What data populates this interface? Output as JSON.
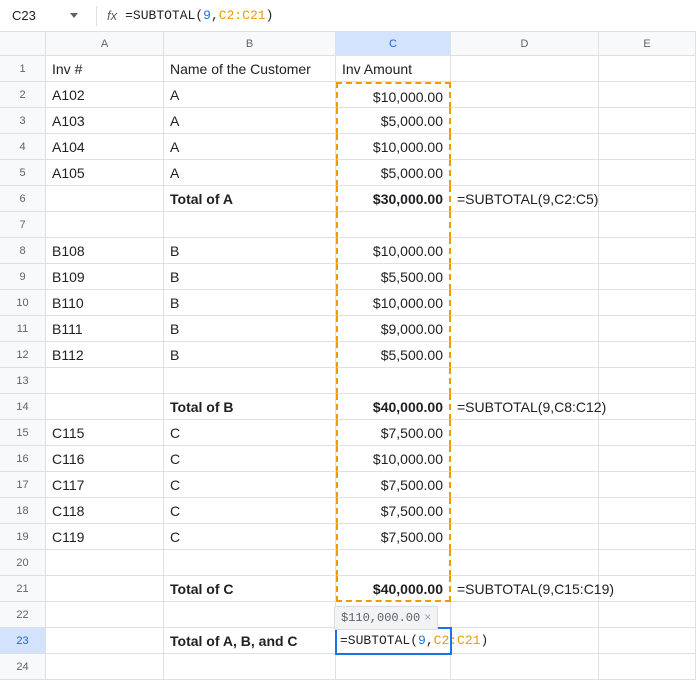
{
  "nameBox": "C23",
  "formulaBar": {
    "prefix": "=SUBTOTAL",
    "open": "(",
    "arg1": "9",
    "sep": ",",
    "arg2": "C2:C21",
    "close": ")"
  },
  "columns": [
    "A",
    "B",
    "C",
    "D",
    "E"
  ],
  "tooltip": {
    "value": "$110,000.00",
    "close": "×"
  },
  "activeFormula": {
    "prefix": "=SUBTOTAL",
    "open": "(",
    "arg1": "9",
    "sep": ",",
    "arg2": "C2:C21",
    "close": ")"
  },
  "rows": [
    {
      "n": "1",
      "a": "Inv #",
      "b": "Name of the Customer",
      "c": "Inv Amount",
      "d": "",
      "cClass": ""
    },
    {
      "n": "2",
      "a": "A102",
      "b": "A",
      "c": "$10,000.00",
      "d": "",
      "cClass": "num"
    },
    {
      "n": "3",
      "a": "A103",
      "b": "A",
      "c": "$5,000.00",
      "d": "",
      "cClass": "num"
    },
    {
      "n": "4",
      "a": "A104",
      "b": "A",
      "c": "$10,000.00",
      "d": "",
      "cClass": "num"
    },
    {
      "n": "5",
      "a": "A105",
      "b": "A",
      "c": "$5,000.00",
      "d": "",
      "cClass": "num"
    },
    {
      "n": "6",
      "a": "",
      "b": "Total of A",
      "bBold": true,
      "c": "$30,000.00",
      "cBold": true,
      "d": "=SUBTOTAL(9,C2:C5)",
      "cClass": "num"
    },
    {
      "n": "7",
      "a": "",
      "b": "",
      "c": "",
      "d": "",
      "cClass": ""
    },
    {
      "n": "8",
      "a": "B108",
      "b": "B",
      "c": "$10,000.00",
      "d": "",
      "cClass": "num"
    },
    {
      "n": "9",
      "a": "B109",
      "b": "B",
      "c": "$5,500.00",
      "d": "",
      "cClass": "num"
    },
    {
      "n": "10",
      "a": "B110",
      "b": "B",
      "c": "$10,000.00",
      "d": "",
      "cClass": "num"
    },
    {
      "n": "11",
      "a": "B111",
      "b": "B",
      "c": "$9,000.00",
      "d": "",
      "cClass": "num"
    },
    {
      "n": "12",
      "a": "B112",
      "b": "B",
      "c": "$5,500.00",
      "d": "",
      "cClass": "num"
    },
    {
      "n": "13",
      "a": "",
      "b": "",
      "c": "",
      "d": "",
      "cClass": ""
    },
    {
      "n": "14",
      "a": "",
      "b": "Total of B",
      "bBold": true,
      "c": "$40,000.00",
      "cBold": true,
      "d": "=SUBTOTAL(9,C8:C12)",
      "cClass": "num"
    },
    {
      "n": "15",
      "a": "C115",
      "b": "C",
      "c": "$7,500.00",
      "d": "",
      "cClass": "num"
    },
    {
      "n": "16",
      "a": "C116",
      "b": "C",
      "c": "$10,000.00",
      "d": "",
      "cClass": "num"
    },
    {
      "n": "17",
      "a": "C117",
      "b": "C",
      "c": "$7,500.00",
      "d": "",
      "cClass": "num"
    },
    {
      "n": "18",
      "a": "C118",
      "b": "C",
      "c": "$7,500.00",
      "d": "",
      "cClass": "num"
    },
    {
      "n": "19",
      "a": "C119",
      "b": "C",
      "c": "$7,500.00",
      "d": "",
      "cClass": "num"
    },
    {
      "n": "20",
      "a": "",
      "b": "",
      "c": "",
      "d": "",
      "cClass": ""
    },
    {
      "n": "21",
      "a": "",
      "b": "Total of C",
      "bBold": true,
      "c": "$40,000.00",
      "cBold": true,
      "d": "=SUBTOTAL(9,C15:C19)",
      "cClass": "num"
    },
    {
      "n": "22",
      "a": "",
      "b": "",
      "c": "",
      "d": "",
      "cClass": ""
    },
    {
      "n": "23",
      "a": "",
      "b": "Total of A, B, and C",
      "bBold": true,
      "cActive": true,
      "d": "",
      "cClass": ""
    },
    {
      "n": "24",
      "a": "",
      "b": "",
      "c": "",
      "d": "",
      "cClass": ""
    }
  ]
}
